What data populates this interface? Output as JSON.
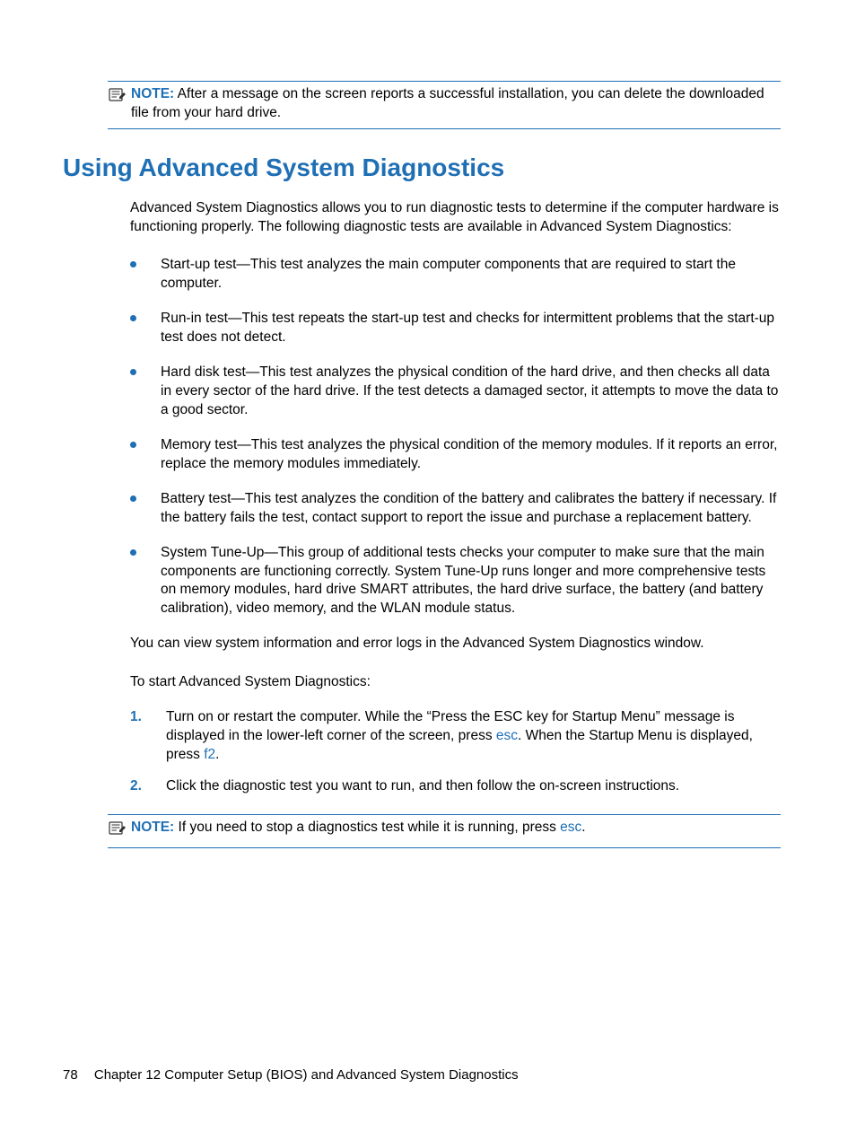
{
  "note1": {
    "label": "NOTE:",
    "text": "After a message on the screen reports a successful installation, you can delete the downloaded file from your hard drive."
  },
  "heading": "Using Advanced System Diagnostics",
  "intro": "Advanced System Diagnostics allows you to run diagnostic tests to determine if the computer hardware is functioning properly. The following diagnostic tests are available in Advanced System Diagnostics:",
  "bullets": [
    "Start-up test—This test analyzes the main computer components that are required to start the computer.",
    "Run-in test—This test repeats the start-up test and checks for intermittent problems that the start-up test does not detect.",
    "Hard disk test—This test analyzes the physical condition of the hard drive, and then checks all data in every sector of the hard drive. If the test detects a damaged sector, it attempts to move the data to a good sector.",
    "Memory test—This test analyzes the physical condition of the memory modules. If it reports an error, replace the memory modules immediately.",
    "Battery test—This test analyzes the condition of the battery and calibrates the battery if necessary. If the battery fails the test, contact support to report the issue and purchase a replacement battery.",
    "System Tune-Up—This group of additional tests checks your computer to make sure that the main components are functioning correctly. System Tune-Up runs longer and more comprehensive tests on memory modules, hard drive SMART attributes, the hard drive surface, the battery (and battery calibration), video memory, and the WLAN module status."
  ],
  "after_bullets": "You can view system information and error logs in the Advanced System Diagnostics window.",
  "steps_intro": "To start Advanced System Diagnostics:",
  "step1": {
    "a": "Turn on or restart the computer. While the “Press the ESC key for Startup Menu” message is displayed in the lower-left corner of the screen, press ",
    "k1": "esc",
    "b": ". When the Startup Menu is displayed, press ",
    "k2": "f2",
    "c": "."
  },
  "step2": "Click the diagnostic test you want to run, and then follow the on-screen instructions.",
  "note2": {
    "label": "NOTE:",
    "a": "If you need to stop a diagnostics test while it is running, press ",
    "k": "esc",
    "b": "."
  },
  "footer": {
    "page": "78",
    "chapter": "Chapter 12   Computer Setup (BIOS) and Advanced System Diagnostics"
  }
}
